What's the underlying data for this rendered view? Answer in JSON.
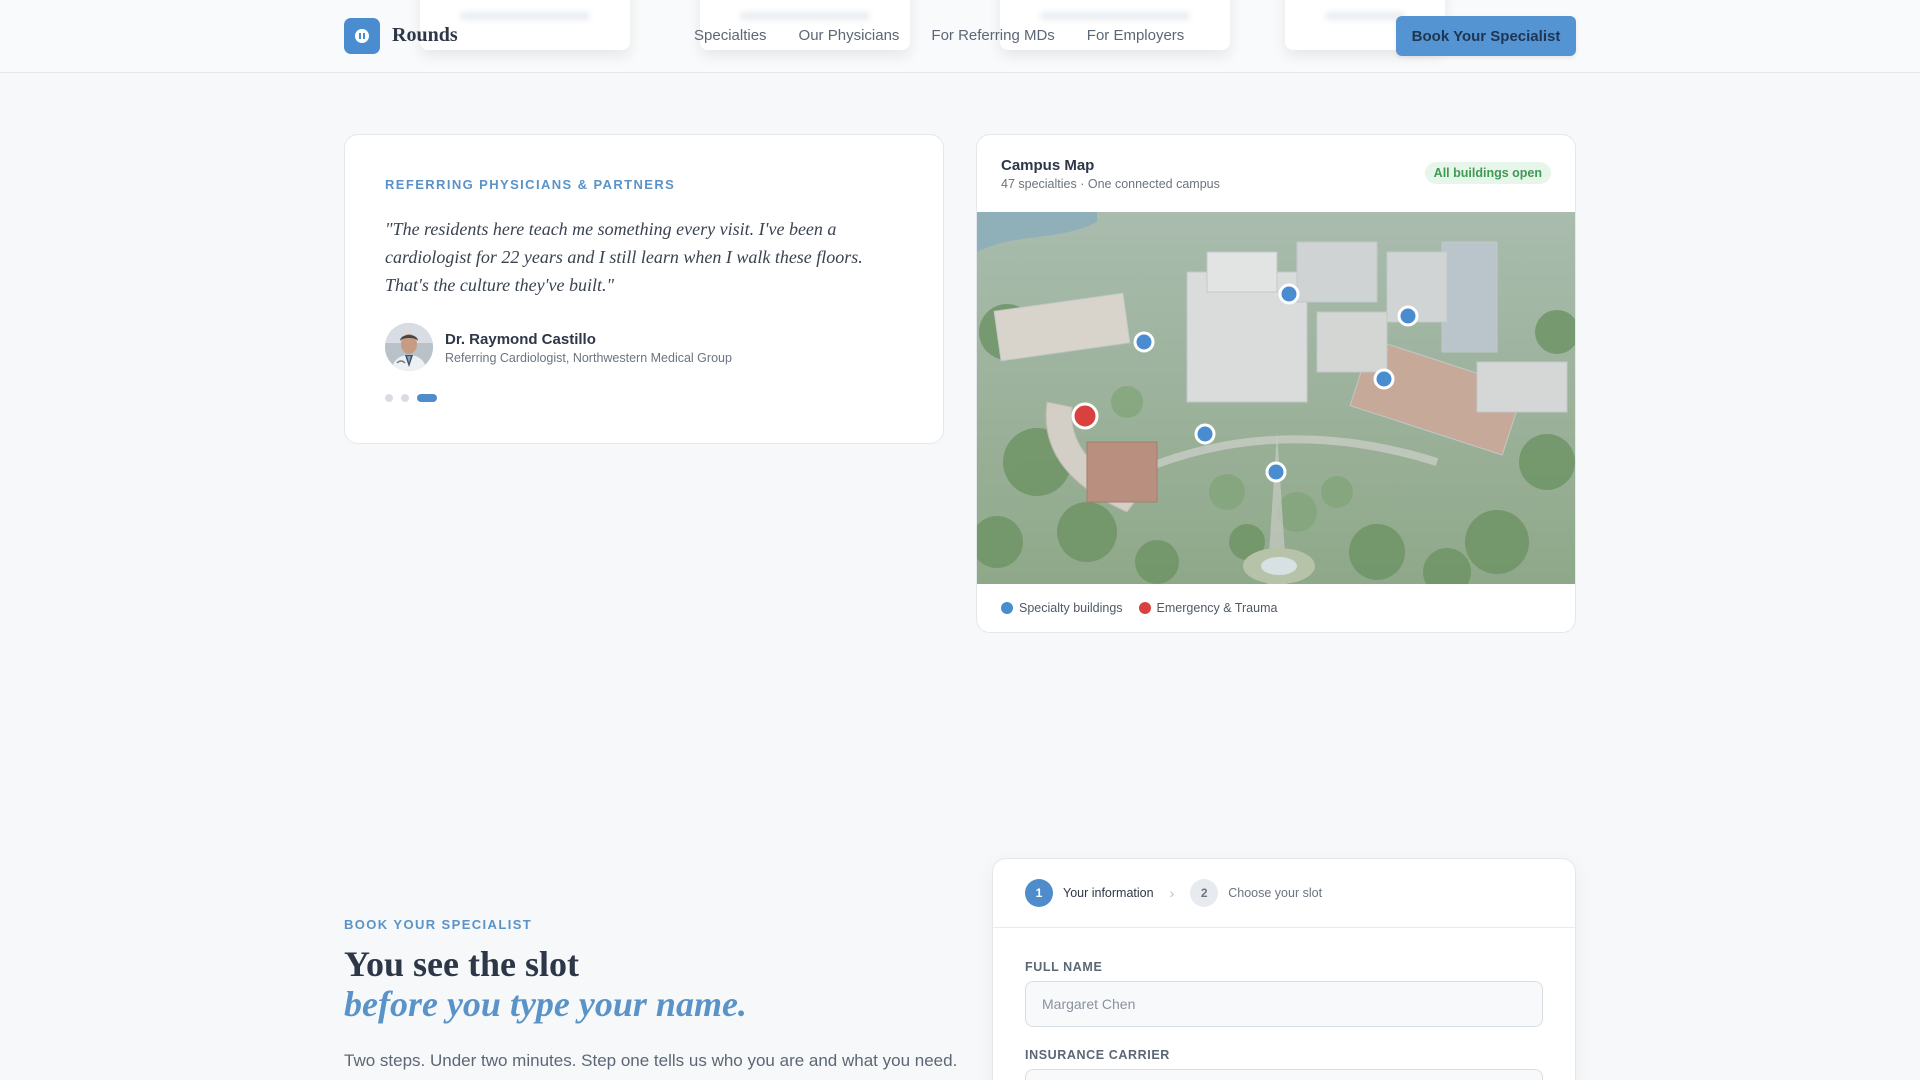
{
  "header": {
    "brand": "Rounds",
    "nav": [
      "Specialties",
      "Our Physicians",
      "For Referring MDs",
      "For Employers"
    ],
    "cta": "Book Your Specialist"
  },
  "testimonial": {
    "eyebrow": "REFERRING PHYSICIANS & PARTNERS",
    "quote": "\"The residents here teach me something every visit. I've been a cardiologist for 22 years and I still learn when I walk these floors. That's the culture they've built.\"",
    "author_name": "Dr. Raymond Castillo",
    "author_role": "Referring Cardiologist, Northwestern Medical Group",
    "carousel_active_index": 2,
    "carousel_count": 3
  },
  "map": {
    "title": "Campus Map",
    "subtitle": "47 specialties · One connected campus",
    "status": "All buildings open",
    "legend": [
      {
        "label": "Specialty buildings",
        "color": "#4a8cd0"
      },
      {
        "label": "Emergency & Trauma",
        "color": "#d9413f"
      }
    ]
  },
  "booking": {
    "eyebrow": "BOOK YOUR SPECIALIST",
    "headline": "You see the slot",
    "headline_em": "before you type your name.",
    "description": "Two steps. Under two minutes. Step one tells us who you are and what you need.",
    "steps": [
      {
        "num": "1",
        "label": "Your information",
        "active": true
      },
      {
        "num": "2",
        "label": "Choose your slot",
        "active": false
      }
    ],
    "full_name_label": "FULL NAME",
    "full_name_placeholder": "Margaret Chen",
    "insurance_label": "INSURANCE CARRIER"
  },
  "colors": {
    "accent": "#4f8ccc",
    "emergency": "#d9413f",
    "status_green": "#3f9b52"
  }
}
